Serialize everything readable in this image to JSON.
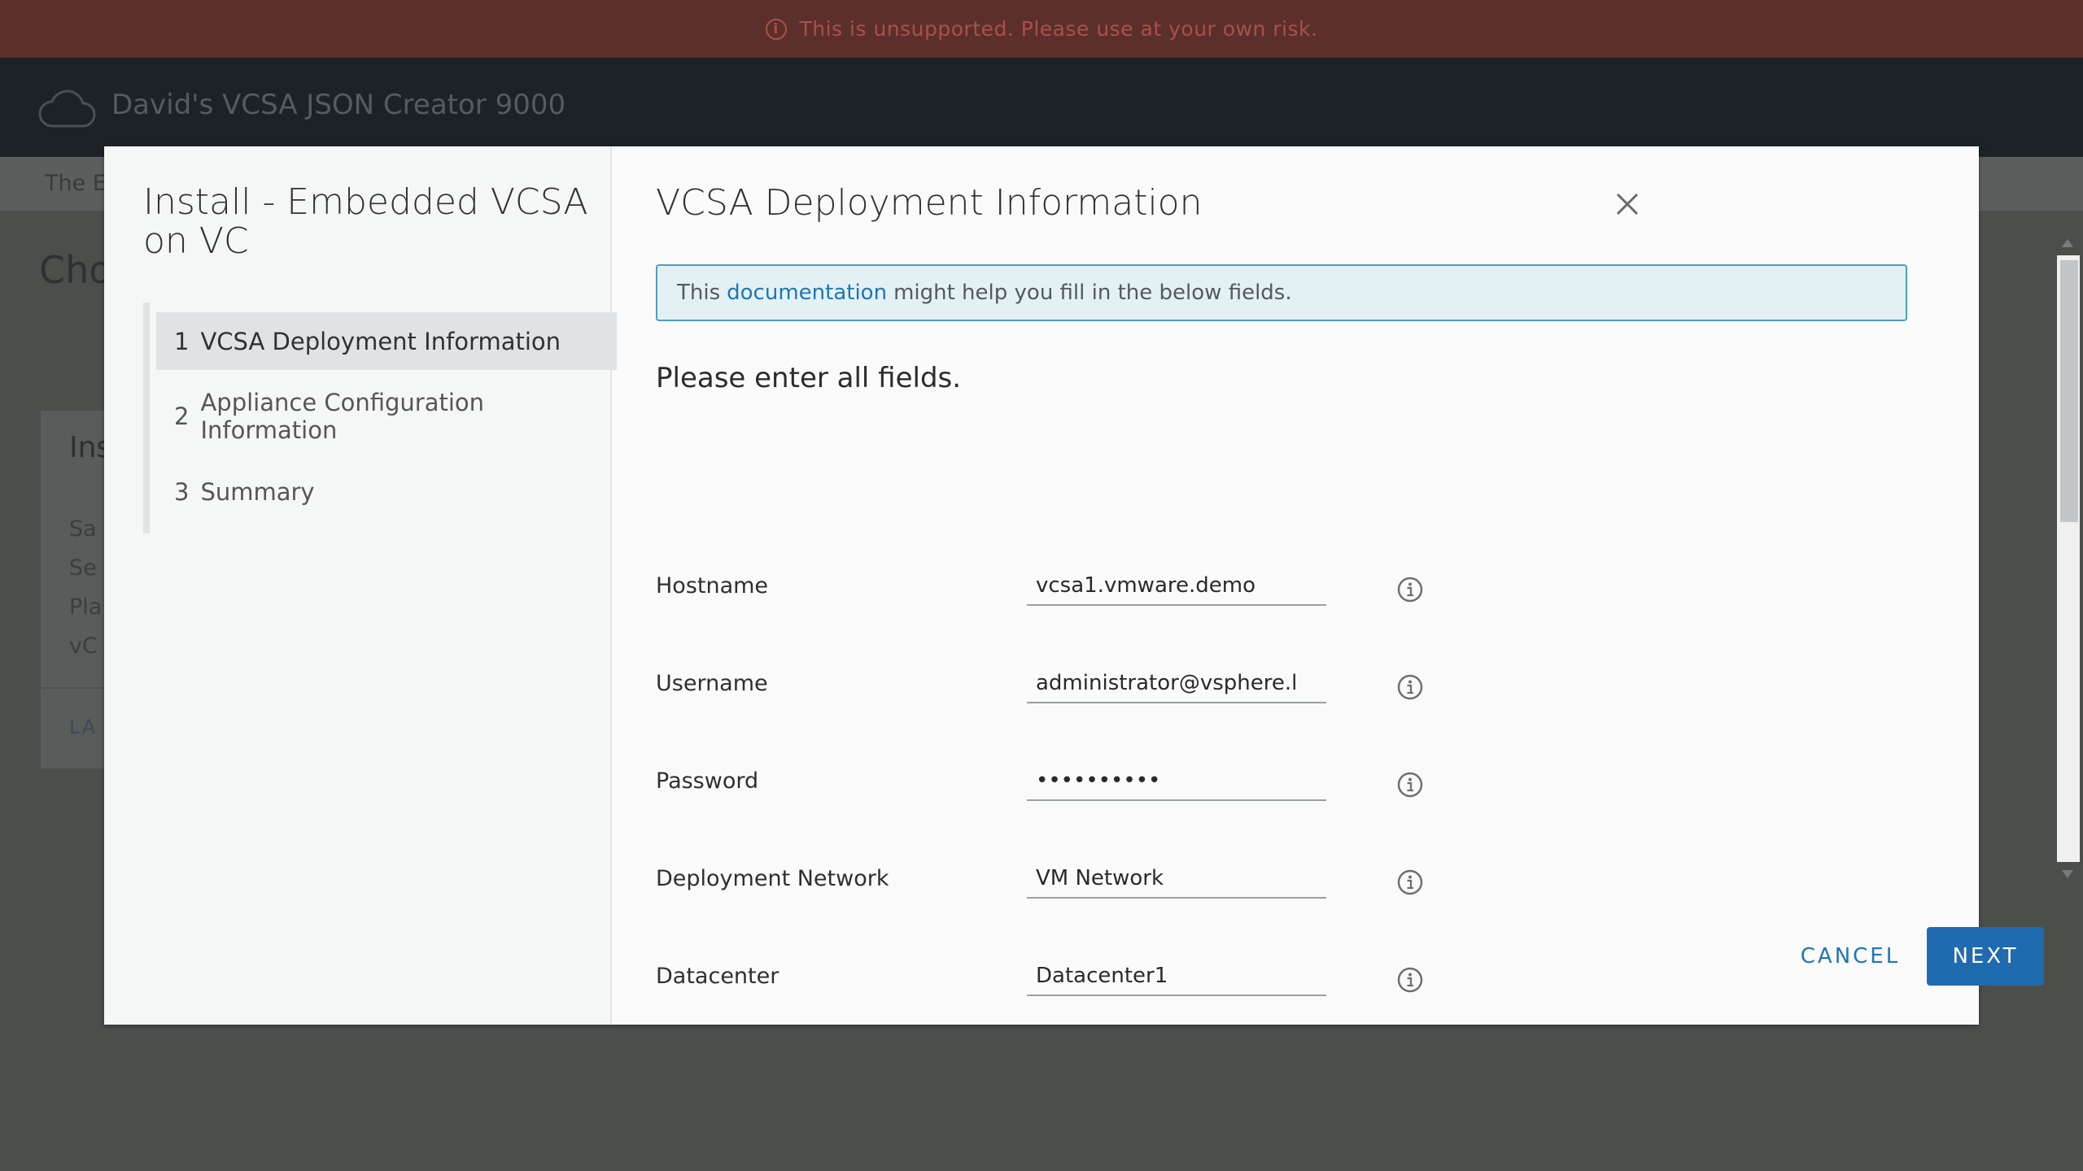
{
  "banner": {
    "text": "This is unsupported. Please use at your own risk."
  },
  "app": {
    "title": "David's VCSA JSON Creator 9000",
    "subnav_text": "The E"
  },
  "background": {
    "heading": "Cho",
    "card": {
      "title": "Ins",
      "lines": [
        "Sa",
        "Se",
        "Pla",
        "vC"
      ],
      "launch": "LA"
    }
  },
  "modal": {
    "wizard_title": "Install - Embedded VCSA on VC",
    "steps": [
      {
        "num": "1",
        "label": "VCSA Deployment Information"
      },
      {
        "num": "2",
        "label": "Appliance Configuration Information"
      },
      {
        "num": "3",
        "label": "Summary"
      }
    ],
    "content_title": "VCSA Deployment Information",
    "alert": {
      "prefix": "This",
      "link": "documentation",
      "suffix": "might help you fill in the below fields."
    },
    "form_heading": "Please enter all fields.",
    "fields": [
      {
        "label": "Hostname",
        "value": "vcsa1.vmware.demo"
      },
      {
        "label": "Username",
        "value": "administrator@vsphere.l"
      },
      {
        "label": "Password",
        "value": "••••••••••"
      },
      {
        "label": "Deployment Network",
        "value": "VM Network"
      },
      {
        "label": "Datacenter",
        "value": "Datacenter1"
      }
    ],
    "buttons": {
      "cancel": "CANCEL",
      "next": "NEXT"
    }
  },
  "colors": {
    "primary": "#1f6bb0",
    "link": "#1e76b5",
    "banner_bg": "#5c2f2b",
    "header_bg": "#1c2226"
  },
  "icons": [
    "info-icon",
    "cloud-icon",
    "close-icon"
  ]
}
